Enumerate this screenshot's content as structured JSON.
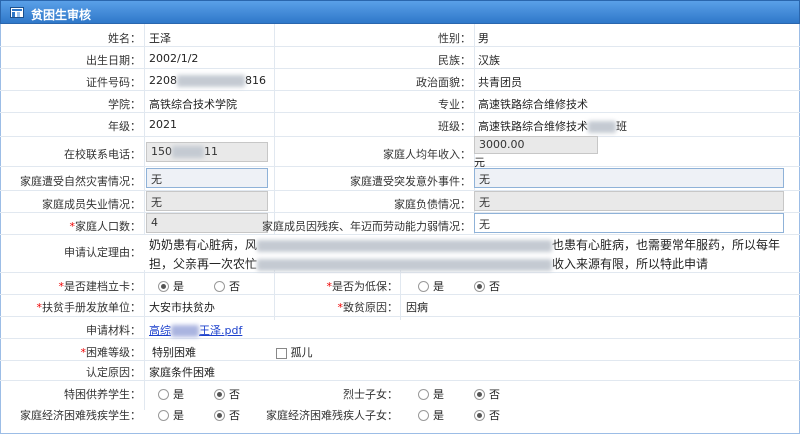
{
  "title": "贫困生审核",
  "form": {
    "name_label": "姓名：",
    "name": "王泽",
    "gender_label": "性别：",
    "gender": "男",
    "birth_label": "出生日期：",
    "birth": "2002/1/2",
    "ethnic_label": "民族：",
    "ethnic": "汉族",
    "id_label": "证件号码：",
    "id_prefix": "2208",
    "id_suffix": "816",
    "political_label": "政治面貌：",
    "political": "共青团员",
    "college_label": "学院：",
    "college": "高铁综合技术学院",
    "major_label": "专业：",
    "major": "高速铁路综合维修技术",
    "grade_label": "年级：",
    "grade": "2021",
    "class_label": "班级：",
    "class_prefix": "高速铁路综合维修技术",
    "class_suffix": "班",
    "phone_label": "在校联系电话：",
    "phone_prefix": "150",
    "phone_suffix": "11",
    "income_label": "家庭人均年收入：",
    "income": "3000.00",
    "income_unit": "元",
    "disaster_label": "家庭遭受自然灾害情况：",
    "disaster": "无",
    "accident_label": "家庭遭受突发意外事件：",
    "accident": "无",
    "unemployed_label": "家庭成员失业情况：",
    "unemployed": "无",
    "debt_label": "家庭负债情况：",
    "debt": "无",
    "people_label": "家庭人口数：",
    "people": "4",
    "disabled_label": "家庭成员因残疾、年迈而劳动能力弱情况：",
    "disabled": "无",
    "reason_label": "申请认定理由：",
    "reason_1a": "奶奶患有心脏病，风",
    "reason_1b": "也患有心脏病，也需要常年服药，所以每年",
    "reason_2a": "担，父亲再一次农忙",
    "reason_2b": "收入来源有限，所以特此申请",
    "card_label": "是否建档立卡：",
    "card_yes": "是",
    "card_no": "否",
    "dibao_label": "是否为低保：",
    "dibao_yes": "是",
    "dibao_no": "否",
    "issuer_label": "扶贫手册发放单位：",
    "issuer": "大安市扶贫办",
    "cause_label": "致贫原因：",
    "cause": "因病",
    "material_label": "申请材料：",
    "material_prefix": "高综",
    "material_suffix": "王泽.pdf",
    "level_label": "困难等级：",
    "level": "特别困难",
    "orphan": "孤儿",
    "basis_label": "认定原因：",
    "basis": "家庭条件困难",
    "tekun_label": "特困供养学生：",
    "tekun_yes": "是",
    "tekun_no": "否",
    "martyr_label": "烈士子女：",
    "martyr_yes": "是",
    "martyr_no": "否",
    "econ_label": "家庭经济困难残疾学生：",
    "econ_yes": "是",
    "econ_no": "否",
    "econchild_label": "家庭经济困难残疾人子女：",
    "econchild_yes": "是",
    "econchild_no": "否"
  }
}
